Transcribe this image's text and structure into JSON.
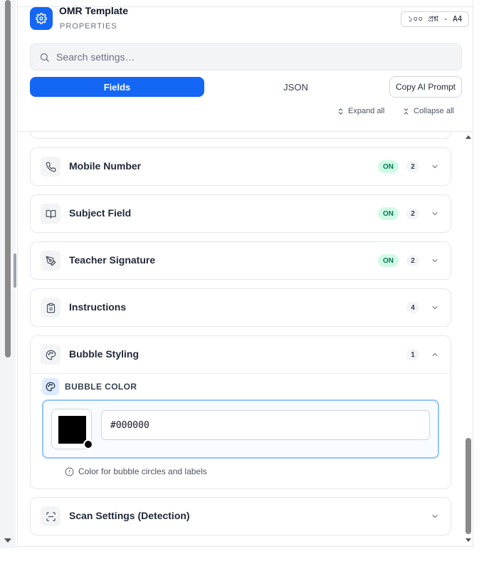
{
  "header": {
    "title": "OMR Template",
    "subtitle": "PROPERTIES",
    "size_badge": "১০০ প্রশ্ন - A4",
    "app_icon": "gear-icon",
    "accent_color": "#1466f5"
  },
  "search": {
    "placeholder": "Search settings…",
    "value": ""
  },
  "tabs": {
    "fields": "Fields",
    "json": "JSON",
    "active": "Fields"
  },
  "actions": {
    "copy_ai_prompt": "Copy AI Prompt",
    "expand_all": "Expand all",
    "collapse_all": "Collapse all"
  },
  "sections": [
    {
      "title": "Mobile Number",
      "icon": "phone-icon",
      "status": "ON",
      "count": "2",
      "expanded": false
    },
    {
      "title": "Subject Field",
      "icon": "book-open-icon",
      "status": "ON",
      "count": "2",
      "expanded": false
    },
    {
      "title": "Teacher Signature",
      "icon": "pen-icon",
      "status": "ON",
      "count": "2",
      "expanded": false
    },
    {
      "title": "Instructions",
      "icon": "clipboard-icon",
      "status": "",
      "count": "4",
      "expanded": false
    },
    {
      "title": "Bubble Styling",
      "icon": "palette-icon",
      "status": "",
      "count": "1",
      "expanded": true
    },
    {
      "title": "Scan Settings (Detection)",
      "icon": "scan-icon",
      "status": "",
      "count": "",
      "expanded": false
    }
  ],
  "bubble_styling": {
    "field_label": "BUBBLE COLOR",
    "hex_value": "#000000",
    "swatch_color": "#000000",
    "hint": "Color for bubble circles and labels"
  }
}
